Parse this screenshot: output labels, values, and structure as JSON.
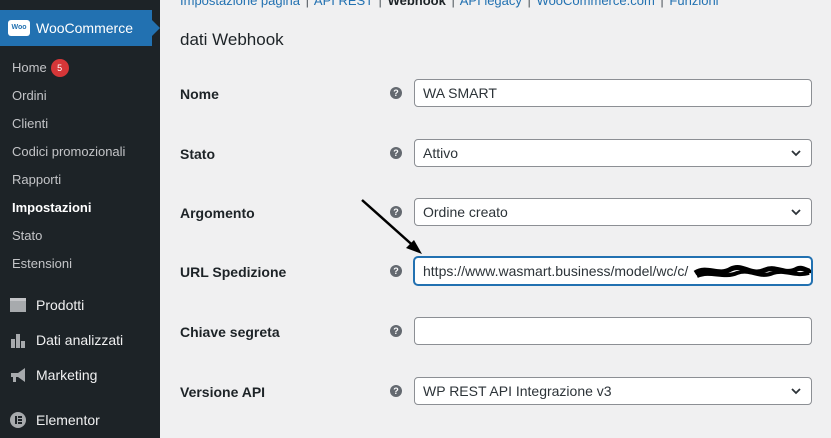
{
  "sidebar": {
    "brand": "WooCommerce",
    "submenu": [
      {
        "label": "Home",
        "badge": "5"
      },
      {
        "label": "Ordini"
      },
      {
        "label": "Clienti"
      },
      {
        "label": "Codici promozionali"
      },
      {
        "label": "Rapporti"
      },
      {
        "label": "Impostazioni",
        "active": true
      },
      {
        "label": "Stato"
      },
      {
        "label": "Estensioni"
      }
    ],
    "menu": [
      {
        "label": "Prodotti",
        "icon": "products-icon"
      },
      {
        "label": "Dati analizzati",
        "icon": "analytics-icon"
      },
      {
        "label": "Marketing",
        "icon": "megaphone-icon"
      },
      {
        "label": "Elementor",
        "icon": "elementor-icon"
      }
    ]
  },
  "topnav": {
    "items": [
      "Impostazione pagina",
      "API REST",
      "Webhook",
      "API legacy",
      "WooCommerce.com",
      "Funzioni"
    ],
    "separator": "|"
  },
  "section_title": "dati Webhook",
  "form": {
    "help_glyph": "?",
    "nome": {
      "label": "Nome",
      "value": "WA SMART"
    },
    "stato": {
      "label": "Stato",
      "value": "Attivo"
    },
    "argomento": {
      "label": "Argomento",
      "value": "Ordine creato"
    },
    "url": {
      "label": "URL Spedizione",
      "value": "https://www.wasmart.business/model/wc/c/"
    },
    "chiave": {
      "label": "Chiave segreta",
      "value": ""
    },
    "versione": {
      "label": "Versione API",
      "value": "WP REST API Integrazione v3"
    }
  },
  "colors": {
    "accent": "#2271b1",
    "sidebar": "#1d2327",
    "badge": "#d63638"
  }
}
